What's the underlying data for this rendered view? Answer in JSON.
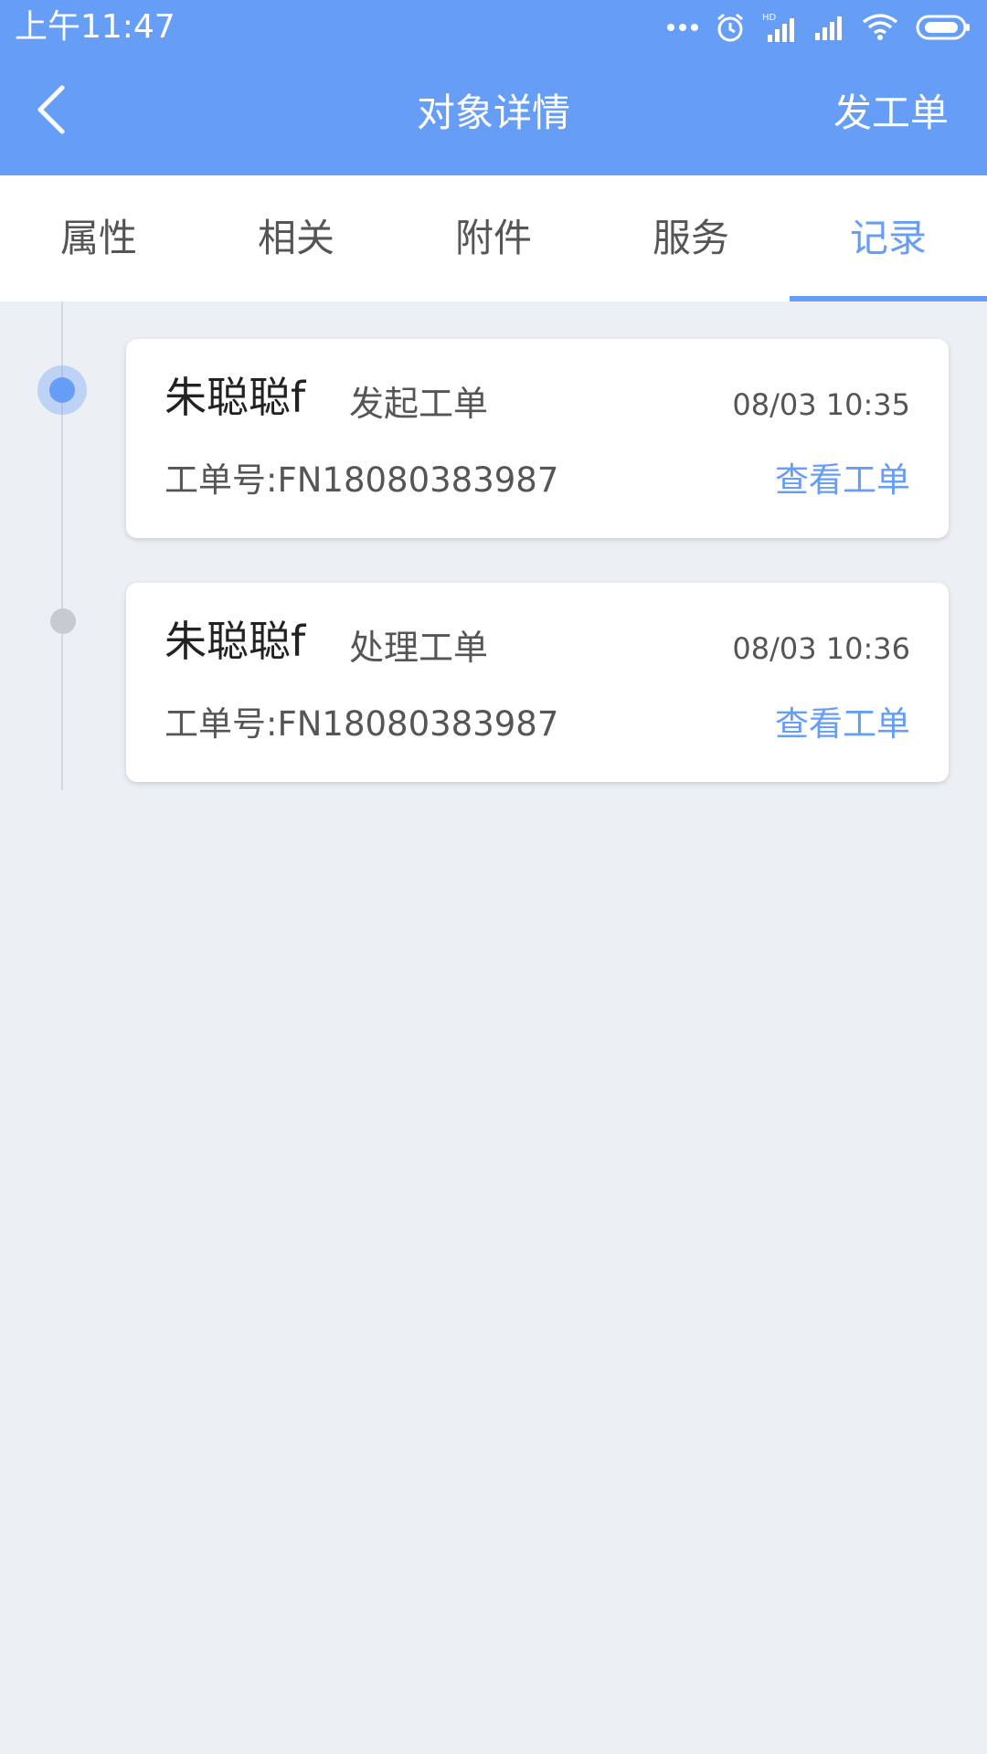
{
  "status_bar": {
    "time": "上午11:47",
    "icons": [
      "more-dots-icon",
      "alarm-icon",
      "hd-signal-icon",
      "signal-icon",
      "wifi-icon",
      "battery-icon"
    ]
  },
  "header": {
    "title": "对象详情",
    "action_label": "发工单",
    "back_icon": "chevron-left-icon",
    "background": "#669df6"
  },
  "tabs": [
    {
      "label": "属性",
      "active": false
    },
    {
      "label": "相关",
      "active": false
    },
    {
      "label": "附件",
      "active": false
    },
    {
      "label": "服务",
      "active": false
    },
    {
      "label": "记录",
      "active": true
    }
  ],
  "records": [
    {
      "name": "朱聪聪f",
      "action": "发起工单",
      "time": "08/03 10:35",
      "order_label": "工单号:",
      "order_no": "FN18080383987",
      "link_label": "查看工单",
      "current": true
    },
    {
      "name": "朱聪聪f",
      "action": "处理工单",
      "time": "08/03 10:36",
      "order_label": "工单号:",
      "order_no": "FN18080383987",
      "link_label": "查看工单",
      "current": false
    }
  ],
  "colors": {
    "accent": "#669df6",
    "page_background": "#eceff4"
  }
}
